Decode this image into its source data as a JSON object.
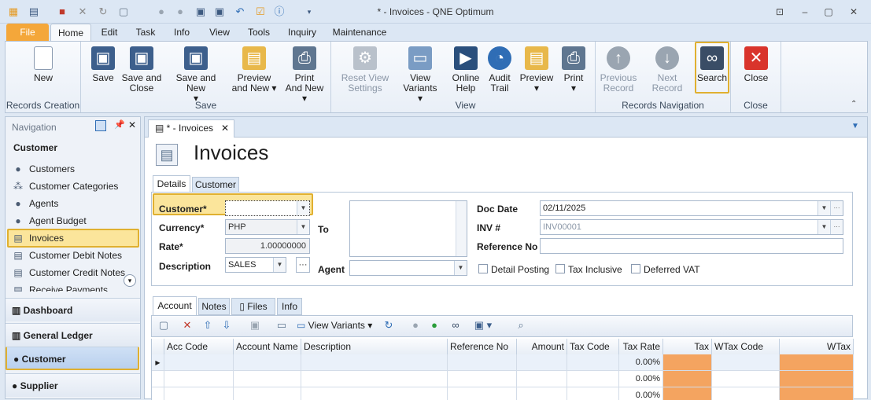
{
  "window": {
    "title": "* - Invoices - QNE Optimum"
  },
  "ribbon": {
    "tabs": [
      "File",
      "Home",
      "Edit",
      "Task",
      "Info",
      "View",
      "Tools",
      "Inquiry",
      "Maintenance"
    ],
    "groups": {
      "records_creation": "Records Creation",
      "save": "Save",
      "view": "View",
      "records_navigation": "Records Navigation",
      "close": "Close"
    },
    "buttons": {
      "new": "New",
      "save": "Save",
      "save_close_1": "Save and",
      "save_close_2": "Close",
      "save_new": "Save and New",
      "preview_new_1": "Preview",
      "preview_new_2": "and New",
      "print_new_1": "Print",
      "print_new_2": "And New",
      "reset_view_1": "Reset View",
      "reset_view_2": "Settings",
      "view_variants": "View Variants",
      "online_help_1": "Online",
      "online_help_2": "Help",
      "audit_trail_1": "Audit",
      "audit_trail_2": "Trail",
      "preview": "Preview",
      "print": "Print",
      "previous_record_1": "Previous",
      "previous_record_2": "Record",
      "next_record": "Next Record",
      "search": "Search",
      "close": "Close"
    }
  },
  "navigation": {
    "title": "Navigation",
    "section": "Customer",
    "items": [
      "Customers",
      "Customer Categories",
      "Agents",
      "Agent Budget",
      "Invoices",
      "Customer Debit Notes",
      "Customer Credit Notes",
      "Receive Payments"
    ],
    "groups": [
      "Dashboard",
      "General Ledger",
      "Customer",
      "Supplier"
    ]
  },
  "document": {
    "tab": "* - Invoices",
    "heading": "Invoices",
    "form_tabs": [
      "Details",
      "Customer"
    ],
    "labels": {
      "customer": "Customer*",
      "currency": "Currency*",
      "rate": "Rate*",
      "description": "Description",
      "to": "To",
      "agent": "Agent",
      "doc_date": "Doc Date",
      "inv_no": "INV #",
      "reference_no": "Reference No"
    },
    "values": {
      "customer": "",
      "currency": "PHP",
      "rate": "1.00000000",
      "description": "SALES",
      "doc_date": "02/11/2025",
      "inv_no": "INV00001",
      "reference_no": ""
    },
    "checks": {
      "detail_posting": "Detail Posting",
      "tax_inclusive": "Tax Inclusive",
      "deferred_vat": "Deferred VAT"
    },
    "detail_tabs": [
      "Account",
      "Notes",
      "Files",
      "Info"
    ],
    "toolbar": {
      "view_variants": "View Variants"
    },
    "grid": {
      "columns": [
        "Acc Code",
        "Account Name",
        "Description",
        "Reference No",
        "Amount",
        "Tax Code",
        "Tax Rate",
        "Tax",
        "WTax Code",
        "WTax"
      ],
      "rows": [
        {
          "tax_rate": "0.00%"
        },
        {
          "tax_rate": "0.00%"
        },
        {
          "tax_rate": "0.00%"
        }
      ]
    }
  }
}
